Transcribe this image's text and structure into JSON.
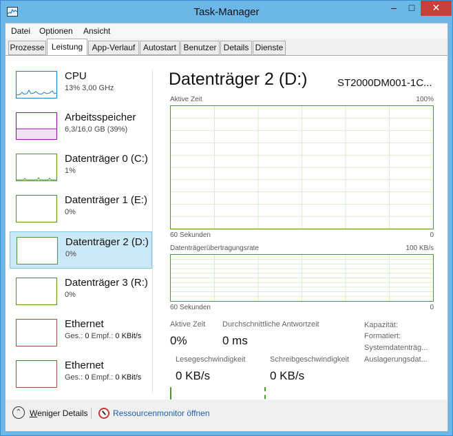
{
  "window": {
    "title": "Task-Manager",
    "controls": {
      "minimize": "–",
      "maximize": "□",
      "close": "✕"
    }
  },
  "menu": [
    "Datei",
    "Optionen",
    "Ansicht"
  ],
  "tabs": [
    "Prozesse",
    "Leistung",
    "App-Verlauf",
    "Autostart",
    "Benutzer",
    "Details",
    "Dienste"
  ],
  "active_tab": "Leistung",
  "sidebar": [
    {
      "name": "CPU",
      "detail": "13% 3,00 GHz",
      "color": "#1a7fc6"
    },
    {
      "name": "Arbeitsspeicher",
      "detail": "6,3/16,0 GB (39%)",
      "color": "#8b1a9c"
    },
    {
      "name": "Datenträger 0 (C:)",
      "detail": "1%",
      "color": "#4c9a2a"
    },
    {
      "name": "Datenträger 1 (E:)",
      "detail": "0%",
      "color": "#4c9a2a"
    },
    {
      "name": "Datenträger 2 (D:)",
      "detail": "0%",
      "color": "#4c9a2a",
      "selected": true
    },
    {
      "name": "Datenträger 3 (R:)",
      "detail": "0%",
      "color": "#4c9a2a"
    },
    {
      "name": "Ethernet",
      "ges_label": "Ges.:",
      "ges_value": "0",
      "empf_label": "Empf.:",
      "empf_value": "0 KBit/s",
      "color": "#a0522d"
    },
    {
      "name": "Ethernet",
      "ges_label": "Ges.:",
      "ges_value": "0",
      "empf_label": "Empf.:",
      "empf_value": "0 KBit/s",
      "color": "#a0522d"
    }
  ],
  "detail": {
    "title": "Datenträger 2 (D:)",
    "model": "ST2000DM001-1C...",
    "graph1": {
      "label": "Aktive Zeit",
      "max": "100%",
      "time": "60 Sekunden",
      "min": "0"
    },
    "graph2": {
      "label": "Datenträgerübertragungsrate",
      "max": "100 KB/s",
      "time": "60 Sekunden",
      "min": "0"
    },
    "stats": {
      "active_time_label": "Aktive Zeit",
      "active_time_value": "0%",
      "response_label": "Durchschnittliche Antwortzeit",
      "response_value": "0 ms",
      "read_label": "Lesegeschwindigkeit",
      "read_value": "0 KB/s",
      "write_label": "Schreibgeschwindigkeit",
      "write_value": "0 KB/s"
    },
    "properties": [
      "Kapazität:",
      "Formatiert:",
      "Systemdatenträg...",
      "Auslagerungsdat..."
    ]
  },
  "footer": {
    "less_details_prefix": "W",
    "less_details_rest": "eniger Details",
    "resource_monitor": "Ressourcenmonitor öffnen"
  },
  "colors": {
    "disk_green": "#4c9a2a",
    "selection": "#cbe8f6",
    "title_bar": "#6bb8e8",
    "close": "#c7413a"
  }
}
